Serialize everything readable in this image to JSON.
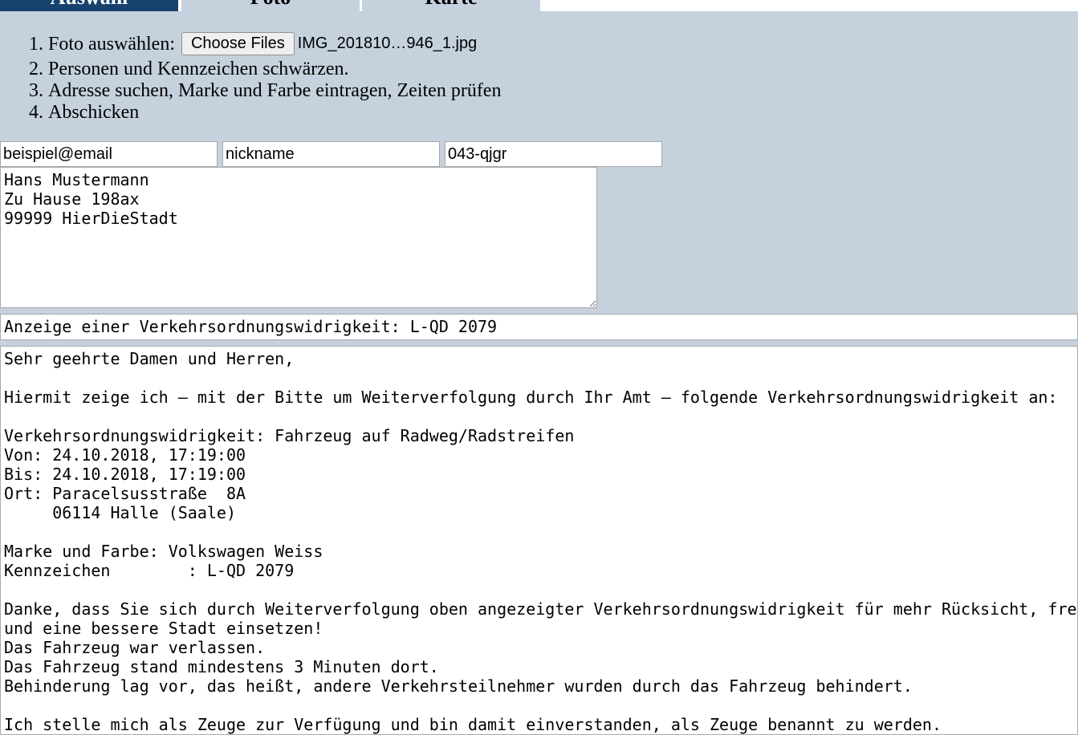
{
  "tabs": [
    {
      "label": "Auswahl",
      "active": true
    },
    {
      "label": "Foto",
      "active": false
    },
    {
      "label": "Karte",
      "active": false
    }
  ],
  "steps": {
    "step1_label": "Foto auswählen:",
    "choose_files_label": "Choose Files",
    "file_name": "IMG_201810…946_1.jpg",
    "step2": "Personen und Kennzeichen schwärzen.",
    "step3": "Adresse suchen, Marke und Farbe eintragen, Zeiten prüfen",
    "step4": "Abschicken"
  },
  "fields": {
    "email": "beispiel@email",
    "nickname": "nickname",
    "code": "043-qjgr"
  },
  "address": "Hans Mustermann\nZu Hause 198ax\n99999 HierDieStadt",
  "subject": "Anzeige einer Verkehrsordnungswidrigkeit: L-QD 2079",
  "body": "Sehr geehrte Damen und Herren,\n\nHiermit zeige ich – mit der Bitte um Weiterverfolgung durch Ihr Amt – folgende Verkehrsordnungswidrigkeit an:\n\nVerkehrsordnungswidrigkeit: Fahrzeug auf Radweg/Radstreifen\nVon: 24.10.2018, 17:19:00\nBis: 24.10.2018, 17:19:00\nOrt: Paracelsusstraße  8A\n     06114 Halle (Saale)\n\nMarke und Farbe: Volkswagen Weiss\nKennzeichen        : L-QD 2079\n\nDanke, dass Sie sich durch Weiterverfolgung oben angezeigter Verkehrsordnungswidrigkeit für mehr Rücksicht, fre\nund eine bessere Stadt einsetzen!\nDas Fahrzeug war verlassen.\nDas Fahrzeug stand mindestens 3 Minuten dort.\nBehinderung lag vor, das heißt, andere Verkehrsteilnehmer wurden durch das Fahrzeug behindert.\n\nIch stelle mich als Zeuge zur Verfügung und bin damit einverstanden, als Zeuge benannt zu werden.",
  "colors": {
    "background": "#c5d1dd",
    "tab_active": "#17426e",
    "tab_inactive": "#c5d1dd"
  }
}
